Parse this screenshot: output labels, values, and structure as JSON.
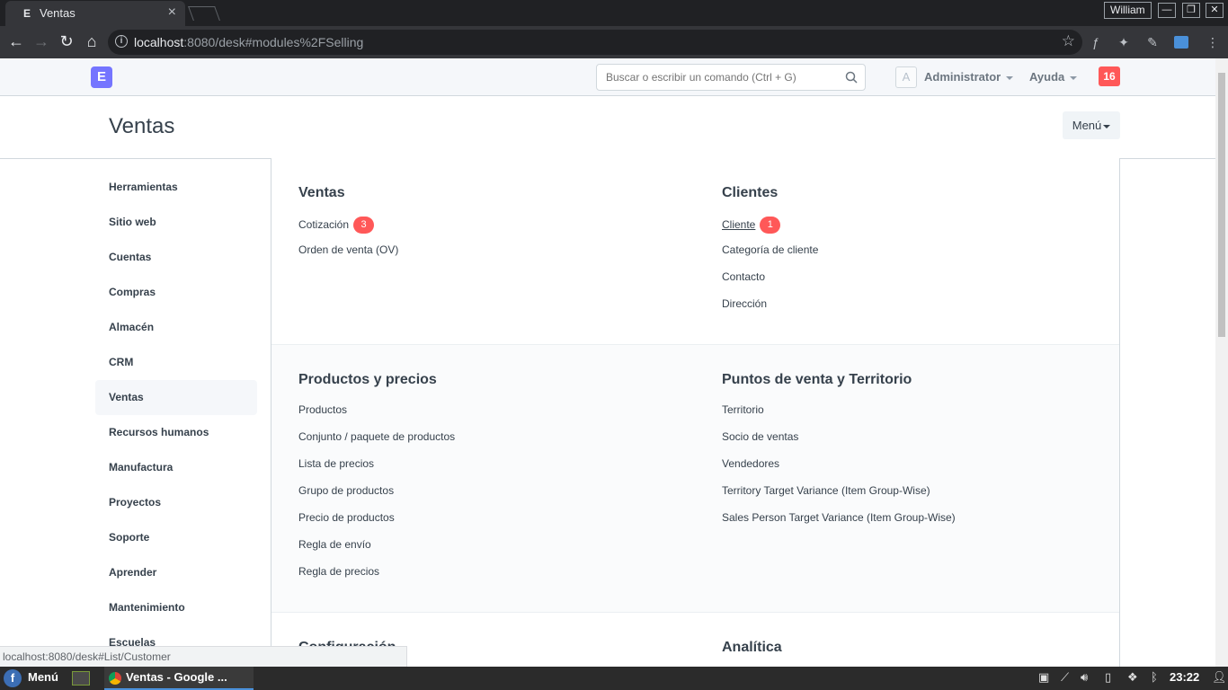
{
  "browser": {
    "tab_favicon": "E",
    "tab_title": "Ventas",
    "tab_close": "×",
    "user": "William",
    "url_host": "localhost",
    "url_rest": ":8080/desk#modules%2FSelling",
    "status_url": "localhost:8080/desk#List/Customer"
  },
  "navbar": {
    "logo": "E",
    "search_placeholder": "Buscar o escribir un comando (Ctrl + G)",
    "avatar": "A",
    "user": "Administrator",
    "help": "Ayuda",
    "notifications": "16"
  },
  "page": {
    "title": "Ventas",
    "menu": "Menú"
  },
  "sidebar": {
    "items": [
      {
        "label": "Herramientas"
      },
      {
        "label": "Sitio web"
      },
      {
        "label": "Cuentas"
      },
      {
        "label": "Compras"
      },
      {
        "label": "Almacén"
      },
      {
        "label": "CRM"
      },
      {
        "label": "Ventas"
      },
      {
        "label": "Recursos humanos"
      },
      {
        "label": "Manufactura"
      },
      {
        "label": "Proyectos"
      },
      {
        "label": "Soporte"
      },
      {
        "label": "Aprender"
      },
      {
        "label": "Mantenimiento"
      },
      {
        "label": "Escuelas"
      }
    ]
  },
  "sections": [
    {
      "left": {
        "title": "Ventas",
        "links": [
          {
            "label": "Cotización",
            "badge": "3"
          },
          {
            "label": "Orden de venta (OV)"
          }
        ]
      },
      "right": {
        "title": "Clientes",
        "links": [
          {
            "label": "Cliente",
            "badge": "1"
          },
          {
            "label": "Categoría de cliente"
          },
          {
            "label": "Contacto"
          },
          {
            "label": "Dirección"
          }
        ]
      }
    },
    {
      "left": {
        "title": "Productos y precios",
        "links": [
          {
            "label": "Productos"
          },
          {
            "label": "Conjunto / paquete de productos"
          },
          {
            "label": "Lista de precios"
          },
          {
            "label": "Grupo de productos"
          },
          {
            "label": "Precio de productos"
          },
          {
            "label": "Regla de envío"
          },
          {
            "label": "Regla de precios"
          }
        ]
      },
      "right": {
        "title": "Puntos de venta y Territorio",
        "links": [
          {
            "label": "Territorio"
          },
          {
            "label": "Socio de ventas"
          },
          {
            "label": "Vendedores"
          },
          {
            "label": "Territory Target Variance (Item Group-Wise)"
          },
          {
            "label": "Sales Person Target Variance (Item Group-Wise)"
          }
        ]
      }
    },
    {
      "left": {
        "title": "Configuración",
        "links": []
      },
      "right": {
        "title": "Analítica",
        "links": []
      }
    }
  ],
  "taskbar": {
    "start": "Menú",
    "window": "Ventas - Google ...",
    "clock": "23:22"
  },
  "colors": {
    "accent": "#7575ff",
    "badge": "#ff5858",
    "chrome_dark": "#202124"
  }
}
